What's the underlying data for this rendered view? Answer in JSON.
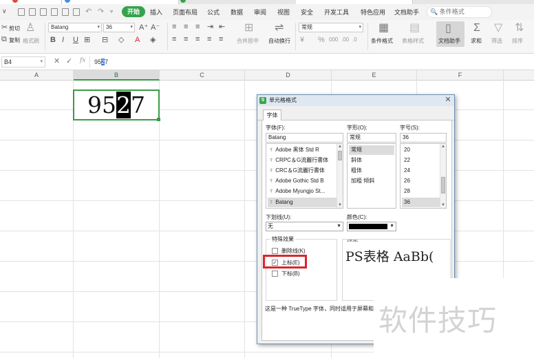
{
  "menubar": {
    "items": [
      "开始",
      "插入",
      "页面布局",
      "公式",
      "数据",
      "审阅",
      "视图",
      "安全",
      "开发工具",
      "特色应用",
      "文档助手"
    ],
    "active": "开始",
    "search_placeholder": "条件格式"
  },
  "ribbon": {
    "cut": "剪切",
    "copy": "复制",
    "format_painter": "格式刷",
    "font_name": "Batang",
    "font_size": "36",
    "merge_center": "合并居中",
    "wrap_text": "自动换行",
    "number_format": "常规",
    "conditional_format": "条件格式",
    "table_style": "表格样式",
    "doc_helper": "文档助手",
    "sum": "求和",
    "filter": "筛选",
    "sort": "排序",
    "active_color": "#35a34c"
  },
  "formula_bar": {
    "name_box": "B4",
    "fx": "fx",
    "value_before": "95",
    "value_selected": "2",
    "value_after": "7"
  },
  "grid": {
    "columns": [
      "A",
      "B",
      "C",
      "D",
      "E",
      "F"
    ],
    "selected_column": "B",
    "cell_b4_before": "95",
    "cell_b4_selected": "2",
    "cell_b4_after": "7"
  },
  "dialog": {
    "title": "单元格格式",
    "tab": "字体",
    "font_label": "字体(F):",
    "font_value": "Batang",
    "font_list": [
      "Adobe 黑体 Std R",
      "CRPC＆G流麗行書体",
      "CRC＆G流麗行書体",
      "Adobe Gothic Std B",
      "Adobe Myungjo St...",
      "Batang"
    ],
    "font_selected": "Batang",
    "style_label": "字形(O):",
    "style_value": "常规",
    "style_list": [
      "常规",
      "斜体",
      "粗体",
      "加粗 倾斜"
    ],
    "style_selected": "常规",
    "size_label": "字号(S):",
    "size_value": "36",
    "size_list": [
      "20",
      "22",
      "24",
      "26",
      "28",
      "36"
    ],
    "size_selected": "36",
    "underline_label": "下划线(U):",
    "underline_value": "无",
    "color_label": "颜色(C):",
    "color_value": "#000000",
    "effects_title": "特殊效果",
    "strikethrough": "删除线(K)",
    "strikethrough_checked": false,
    "superscript": "上标(E)",
    "superscript_checked": true,
    "subscript": "下标(B)",
    "subscript_checked": false,
    "preview_title": "预览",
    "preview_text": "PS表格  AaBb(",
    "description": "这是一种 TrueType 字体，同时适用于屏幕和"
  },
  "watermark": "软件技巧",
  "colors": {
    "highlight": "#d9262c",
    "selection": "#3a9a45"
  }
}
